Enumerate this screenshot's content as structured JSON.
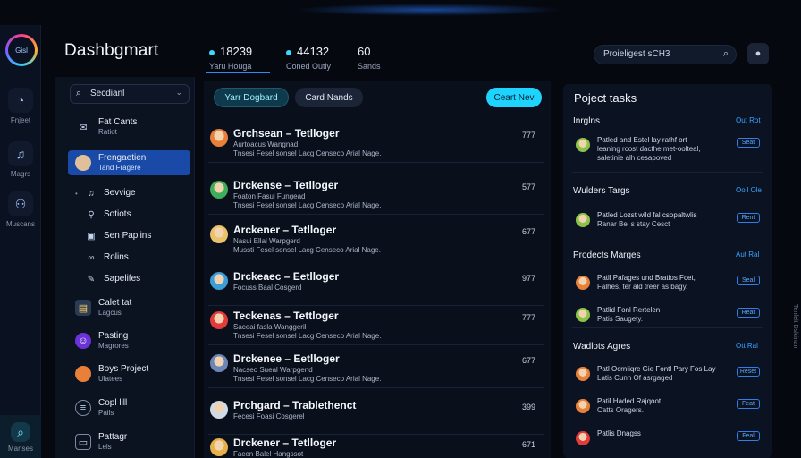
{
  "rail": {
    "logo_label": "Gisl",
    "items": [
      {
        "label": "Fnjeet",
        "icon": "gauge-icon"
      },
      {
        "label": "Magrs",
        "icon": "music-note-icon"
      },
      {
        "label": "Muscans",
        "icon": "people-icon"
      }
    ],
    "bottom_label": "Manses"
  },
  "header": {
    "title": "Dashbgmart",
    "stats": [
      {
        "value": "18239",
        "label": "Yaru Houga"
      },
      {
        "value": "44132",
        "label": "Coned Outly"
      },
      {
        "value": "60",
        "label": "Sands"
      }
    ],
    "search": {
      "placeholder": "Proieligest sCH3"
    }
  },
  "sidebar": {
    "search": {
      "placeholder": "Secdianl"
    },
    "items": [
      {
        "t1": "Fat Cants",
        "t2": "Ratiot",
        "icon": "chat-icon"
      },
      {
        "t1": "Frengaetien",
        "t2": "Tand Fragere",
        "icon": "avatar",
        "active": true
      },
      {
        "t1": "Sevvige",
        "t2": "",
        "icon": "music-note-icon"
      },
      {
        "t1": "Sotiots",
        "t2": "",
        "icon": "pin-icon"
      },
      {
        "t1": "Sen Paplins",
        "t2": "",
        "icon": "camera-icon"
      },
      {
        "t1": "Rolins",
        "t2": "",
        "icon": "link-icon"
      },
      {
        "t1": "Sapelifes",
        "t2": "",
        "icon": "pen-icon"
      },
      {
        "t1": "Calet tat",
        "t2": "Lagcus",
        "icon": "tablet-icon"
      },
      {
        "t1": "Pasting",
        "t2": "Magrores",
        "icon": "discord-icon"
      },
      {
        "t1": "Boys Project",
        "t2": "Ulatees",
        "icon": "avatar"
      },
      {
        "t1": "Copl lill",
        "t2": "Pails",
        "icon": "list-icon"
      },
      {
        "t1": "Pattagr",
        "t2": "Lels",
        "icon": "document-icon"
      }
    ]
  },
  "main": {
    "tabs": [
      "Yarr Dogbard",
      "Card Nands"
    ],
    "action": "Ceart Nev",
    "rows": [
      {
        "title": "Grchsean – Tetlloger",
        "sub1": "Aurtoacus Wangnad",
        "sub2": "Tnsesi Fesel sonsel Lacg Censeco Arial Nage.",
        "num": "777",
        "color": "#e8803a"
      },
      {
        "title": "Drckense – Tetlloger",
        "sub1": "Foaton Fasul Fungead",
        "sub2": "Tnsesi Fesel sonsel Lacg Censeco Arial Nage.",
        "num": "577",
        "color": "#3fae5a"
      },
      {
        "title": "Arckener – Tetlloger",
        "sub1": "Nasui Ellal Warpgerd",
        "sub2": "Mussti Fesel sonsel Lacg Censeco Arial Nage.",
        "num": "677",
        "color": "#e9c26a"
      },
      {
        "title": "Drckeaec – Eetlloger",
        "sub1": "Focuss Baal Cosgerd",
        "sub2": "",
        "num": "977",
        "color": "#3b9ed8"
      },
      {
        "title": "Teckenas – Tettloger",
        "sub1": "Saceai fasla Wanggeril",
        "sub2": "Tnsesi Fesel sonsel Lacg Censeco Arial Nage.",
        "num": "777",
        "color": "#e23b3b"
      },
      {
        "title": "Drckenee – Eetlloger",
        "sub1": "Nacseo Sueal Warpgend",
        "sub2": "Tnsesi Fesel sonsel Lacg Censeco Arial Nage.",
        "num": "677",
        "color": "#6d86b8"
      },
      {
        "title": "Prchgard – Trablethenct",
        "sub1": "Fecesi Foasi Cosgerel",
        "sub2": "",
        "num": "399",
        "color": "#d0dbe8"
      },
      {
        "title": "Drckener – Tetlloger",
        "sub1": "Facen Balel Hangssot",
        "sub2": "",
        "num": "671",
        "color": "#e8b048"
      }
    ]
  },
  "right_panel": {
    "title": "Poject tasks",
    "sections": [
      {
        "heading": "Inrglns",
        "link": "Out Rot",
        "items": [
          {
            "l1": "Patled and Estel lay rathf ort",
            "l2": "leaning rcost dacthe met-oolteal,",
            "l3": "saletinie alh cesapoved",
            "tag": "Seat",
            "color": "#8bc34a"
          }
        ]
      },
      {
        "heading": "Wulders Targs",
        "link": "Ooll Ole",
        "items": [
          {
            "l1": "Patled Lozst wild fal csopaltwlis",
            "l2": "Ranar Bel s stay Cesct",
            "l3": "",
            "tag": "Rent",
            "color": "#8bc34a"
          }
        ]
      },
      {
        "heading": "Prodects Marges",
        "link": "Aut Ral",
        "items": [
          {
            "l1": "Patll Pafages und Bratios Fcet,",
            "l2": "Falhes, ter ald treer as bagy.",
            "l3": "",
            "tag": "Seal",
            "color": "#e8803a"
          },
          {
            "l1": "Patlid Fonl Rertelen",
            "l2": "Patis Saugety.",
            "l3": "",
            "tag": "Reat",
            "color": "#8bc34a"
          }
        ]
      },
      {
        "heading": "Wadlots Agres",
        "link": "Ott Ral",
        "items": [
          {
            "l1": "Patl Ocrnliqre Gie Fontl Pary Fos Lay",
            "l2": "Latis Cunn Of asrgaged",
            "l3": "",
            "tag": "Reset",
            "color": "#e8803a"
          },
          {
            "l1": "Patil Haded Rajqoot",
            "l2": "Catts Oragers.",
            "l3": "",
            "tag": "Feat",
            "color": "#e8803a"
          },
          {
            "l1": "Patlis Dnagss",
            "l2": "",
            "l3": "",
            "tag": "Feal",
            "color": "#e23b3b"
          }
        ]
      }
    ]
  },
  "side_caption": "Tenfelt Dslcinan"
}
